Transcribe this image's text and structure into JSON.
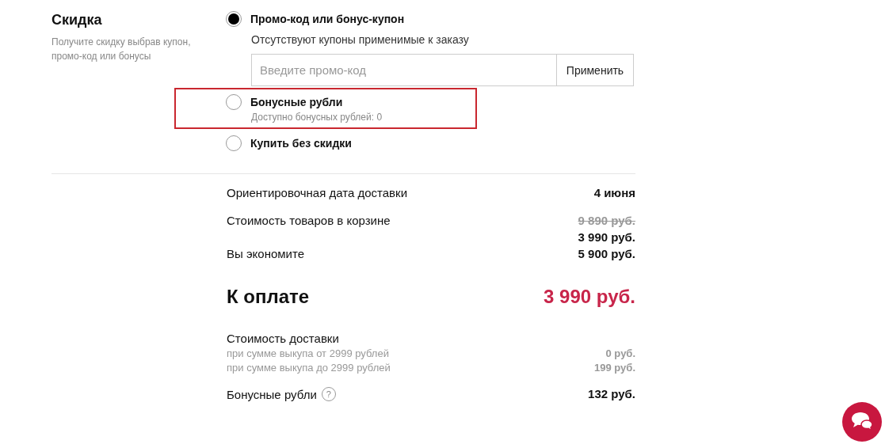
{
  "discount": {
    "title": "Скидка",
    "description": "Получите скидку выбрав купон, промо-код или бонусы",
    "options": [
      {
        "kind": "promo",
        "label": "Промо-код или бонус-купон",
        "note": "Отсутствуют купоны применимые к заказу",
        "selected": true,
        "highlighted": false,
        "field": {
          "placeholder": "Введите промо-код"
        },
        "button": "Применить"
      },
      {
        "kind": "plain",
        "label": "Бонусные рубли",
        "note": "Доступно бонусных рублей: 0",
        "selected": false,
        "highlighted": true
      },
      {
        "kind": "plain",
        "label": "Купить без скидки",
        "selected": false,
        "highlighted": false
      }
    ]
  },
  "summary": {
    "delivery_date": {
      "label": "Ориентировочная дата доставки",
      "value": "4 июня"
    },
    "cart_cost": {
      "label": "Стоимость товаров в корзине",
      "old_value": "9 890 руб.",
      "value": "3 990 руб."
    },
    "savings": {
      "label": "Вы экономите",
      "value": "5 900 руб."
    },
    "total": {
      "label": "К оплате",
      "value": "3 990 руб."
    },
    "delivery_cost": {
      "label": "Стоимость доставки",
      "tiers": [
        {
          "label": "при сумме выкупа от 2999 рублей",
          "value": "0 руб."
        },
        {
          "label": "при сумме выкупа до 2999 рублей",
          "value": "199 руб."
        }
      ]
    },
    "bonus": {
      "label": "Бонусные рубли",
      "help": "?",
      "value": "132 руб."
    }
  }
}
